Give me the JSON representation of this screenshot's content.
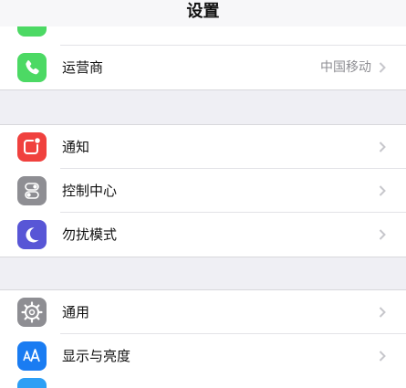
{
  "nav": {
    "title": "设置"
  },
  "group1": {
    "carrier": {
      "label": "运营商",
      "value": "中国移动",
      "icon": "phone-icon",
      "color": "#4cd964"
    }
  },
  "group2": {
    "items": [
      {
        "label": "通知",
        "icon": "notification-icon",
        "color": "#f0413e"
      },
      {
        "label": "控制中心",
        "icon": "toggle-switches-icon",
        "color": "#8e8e93"
      },
      {
        "label": "勿扰模式",
        "icon": "moon-icon",
        "color": "#5856d6"
      }
    ]
  },
  "group3": {
    "items": [
      {
        "label": "通用",
        "icon": "gear-icon",
        "color": "#8e8e93"
      },
      {
        "label": "显示与亮度",
        "icon": "text-size-icon",
        "color": "#1a7cf2"
      }
    ]
  }
}
